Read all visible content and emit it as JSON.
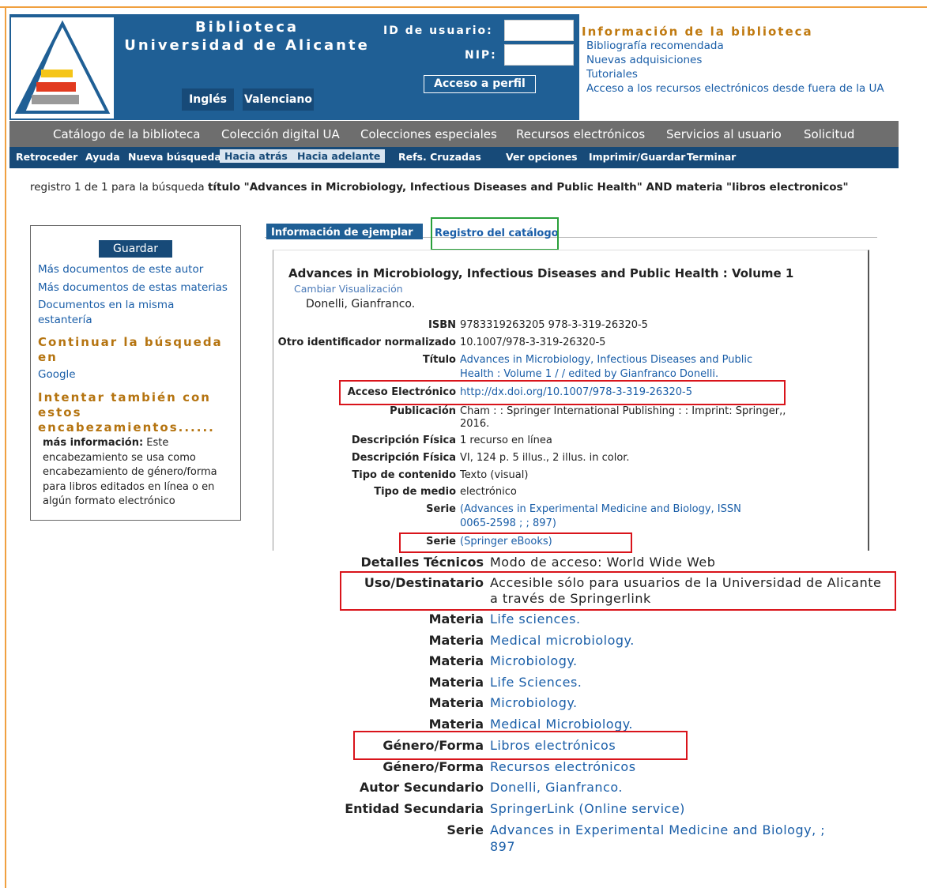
{
  "header": {
    "library_title_1": "Biblioteca",
    "library_title_2": "Universidad de Alicante",
    "user_id_label": "ID de usuario:",
    "pin_label": "NIP:",
    "profile_button": "Acceso a perfil",
    "lang_english": "Inglés",
    "lang_valencian": "Valenciano",
    "info_title": "Información de la biblioteca",
    "info_links": [
      "Bibliografía recomendada",
      "Nuevas adquisiciones",
      "Tutoriales",
      "Acceso a los recursos electrónicos desde fuera de la UA"
    ]
  },
  "main_nav": [
    "Catálogo de la biblioteca",
    "Colección digital UA",
    "Colecciones especiales",
    "Recursos electrónicos",
    "Servicios al usuario",
    "Solicitud"
  ],
  "toolbar": [
    "Retroceder",
    "Ayuda",
    "Nueva búsqueda",
    "Hacia atrás",
    "Hacia adelante",
    "Refs. Cruzadas",
    "Ver opciones",
    "Imprimir/Guardar",
    "Terminar"
  ],
  "search_summary": {
    "prefix": "registro 1 de 1 para la búsqueda ",
    "query": "título \"Advances in Microbiology, Infectious Diseases and Public Health\" AND materia \"libros electronicos\""
  },
  "sidebar": {
    "save_button": "Guardar",
    "link_author": "Más documentos de este autor",
    "link_subjects": "Más documentos de estas materias",
    "link_shelf": "Documentos en la misma estantería",
    "continue_head": "Continuar la búsqueda en",
    "google": "Google",
    "try_head": "Intentar también con estos encabezamientos......",
    "more_info_label": "más información:",
    "more_info_text": " Este encabezamiento se usa como encabezamiento de género/forma para libros editados en línea o en algún formato electrónico"
  },
  "tabs": {
    "item_info": "Información de ejemplar",
    "catalog_record": "Registro del catálogo"
  },
  "record": {
    "title": "Advances in Microbiology, Infectious Diseases and Public Health : Volume 1",
    "change_view": "Cambiar Visualización",
    "author": "Donelli, Gianfranco.",
    "fields": [
      {
        "label": "ISBN",
        "value": "9783319263205 978-3-319-26320-5"
      },
      {
        "label": "Otro identificador normalizado",
        "value": "10.1007/978-3-319-26320-5"
      },
      {
        "label": "Título",
        "value_1": "Advances in Microbiology, Infectious Diseases and Public",
        "value_2": "Health : Volume 1 / / edited by Gianfranco Donelli."
      },
      {
        "label": "Acceso Electrónico",
        "value": "http://dx.doi.org/10.1007/978-3-319-26320-5"
      },
      {
        "label": "Publicación",
        "value_1": "Cham : : Springer International Publishing : : Imprint: Springer,,",
        "value_2": "2016."
      },
      {
        "label": "Descripción Física",
        "value": "1 recurso en línea"
      },
      {
        "label": "Descripción Física",
        "value": "VI, 124 p. 5 illus., 2 illus. in color."
      },
      {
        "label": "Tipo de contenido",
        "value": "Texto (visual)"
      },
      {
        "label": "Tipo de medio",
        "value": "electrónico"
      },
      {
        "label": "Serie",
        "value_1": "(Advances in Experimental Medicine and Biology, ISSN",
        "value_2": "0065-2598 ; ; 897)"
      },
      {
        "label": "Serie",
        "value": "(Springer eBooks)"
      }
    ],
    "fields_large": [
      {
        "label": "Detalles Técnicos",
        "value": "Modo de acceso: World Wide Web"
      },
      {
        "label": "Uso/Destinatario",
        "value_1": "Accesible sólo para usuarios de la Universidad de Alicante",
        "value_2": "a través de Springerlink"
      },
      {
        "label": "Materia",
        "value": "Life sciences."
      },
      {
        "label": "Materia",
        "value": "Medical microbiology."
      },
      {
        "label": "Materia",
        "value": "Microbiology."
      },
      {
        "label": "Materia",
        "value": "Life Sciences."
      },
      {
        "label": "Materia",
        "value": "Microbiology."
      },
      {
        "label": "Materia",
        "value": "Medical Microbiology."
      },
      {
        "label": "Género/Forma",
        "value": "Libros electrónicos"
      },
      {
        "label": "Género/Forma",
        "value": "Recursos electrónicos"
      },
      {
        "label": "Autor Secundario",
        "value": "Donelli, Gianfranco."
      },
      {
        "label": "Entidad Secundaria",
        "value": "SpringerLink (Online service)"
      },
      {
        "label": "Serie",
        "value_1": "Advances in Experimental Medicine and Biology, ;",
        "value_2": "897"
      }
    ]
  },
  "colors": {
    "header_blue": "#1f5f95",
    "nav_gray": "#6e6e6e",
    "toolbar_blue": "#174a78",
    "link_blue": "#1a5ea8",
    "highlight_red": "#d9141b",
    "highlight_green": "#29a03a",
    "accent_orange": "#c07a10"
  }
}
